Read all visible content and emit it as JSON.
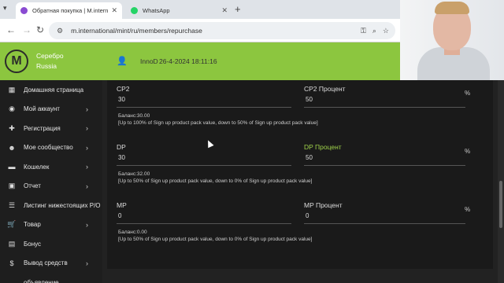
{
  "browser": {
    "tabs": [
      {
        "title": "Обратная покупка | M.internation",
        "favicon_color": "#8a4bd2"
      },
      {
        "title": "WhatsApp",
        "favicon_color": "#25d366"
      }
    ],
    "url": "m.international/mint/ru/members/repurchase"
  },
  "brand": {
    "line1": "Серебро",
    "line2": "Russia"
  },
  "header": {
    "username": "InnoD",
    "datetime": "26-4-2024 18:11:16"
  },
  "sidebar": {
    "items": [
      {
        "label": "Домашняя страница",
        "icon": "▦",
        "has_arrow": false
      },
      {
        "label": "Мой аккаунт",
        "icon": "◉",
        "has_arrow": true
      },
      {
        "label": "Регистрация",
        "icon": "✚",
        "has_arrow": true
      },
      {
        "label": "Мое сообщество",
        "icon": "☻",
        "has_arrow": true
      },
      {
        "label": "Кошелек",
        "icon": "▬",
        "has_arrow": true
      },
      {
        "label": "Отчет",
        "icon": "▣",
        "has_arrow": true
      },
      {
        "label": "Листинг нижестоящих P/O",
        "icon": "☰",
        "has_arrow": false
      },
      {
        "label": "Товар",
        "icon": "🛒",
        "has_arrow": true
      },
      {
        "label": "Бонус",
        "icon": "▤",
        "has_arrow": false
      },
      {
        "label": "Вывод средств",
        "icon": "$",
        "has_arrow": true
      },
      {
        "label": "объявление",
        "icon": "",
        "has_arrow": false
      }
    ]
  },
  "form": {
    "rows": [
      {
        "left_label": "CP2",
        "left_value": "30",
        "right_label": "CP2 Процент",
        "right_value": "50",
        "right_label_green": false,
        "unit": "%",
        "balance": "Баланс:30.00",
        "note": "[Up to 100% of Sign up product pack value, down to 50% of Sign up product pack value]"
      },
      {
        "left_label": "DP",
        "left_value": "30",
        "right_label": "DP Процент",
        "right_value": "50",
        "right_label_green": true,
        "unit": "%",
        "balance": "Баланс:32.00",
        "note": "[Up to 50% of Sign up product pack value, down to 0% of Sign up product pack value]"
      },
      {
        "left_label": "MP",
        "left_value": "0",
        "right_label": "MP Процент",
        "right_value": "0",
        "right_label_green": false,
        "unit": "%",
        "balance": "Баланс:0.00",
        "note": "[Up to 50% of Sign up product pack value, down to 0% of Sign up product pack value]"
      }
    ]
  },
  "colors": {
    "accent": "#8cc63f",
    "sidebar_bg": "#1e1e1e",
    "content_bg": "#1a1a1a"
  }
}
